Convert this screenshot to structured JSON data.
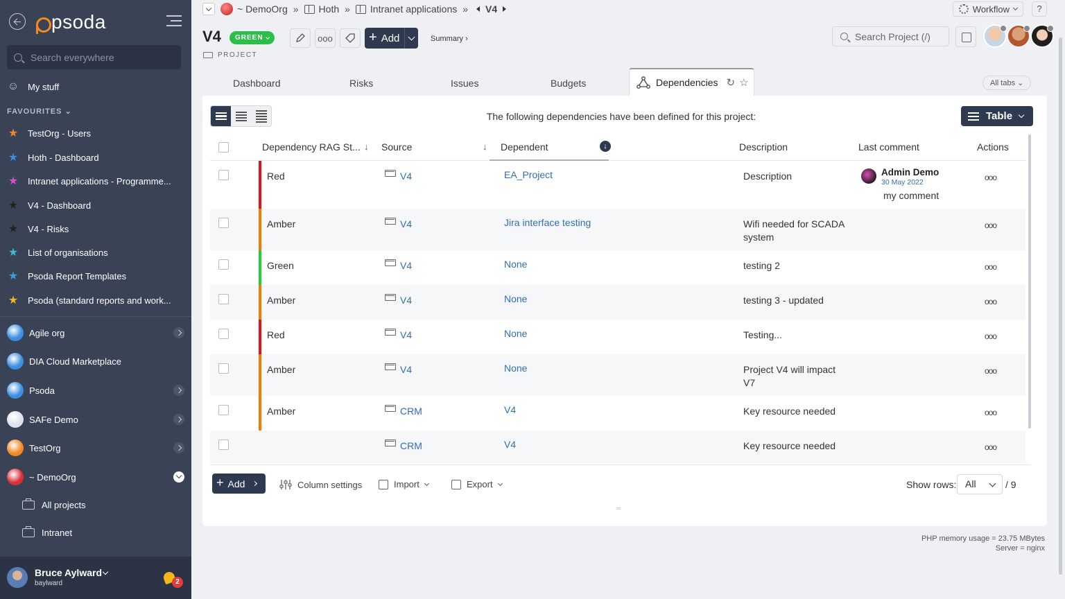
{
  "sidebar": {
    "logo_text": "psoda",
    "search_placeholder": "Search everywhere",
    "my_stuff": "My stuff",
    "favourites_title": "FAVOURITES",
    "favourites": [
      {
        "label": "TestOrg - Users",
        "color": "#f28a24"
      },
      {
        "label": "Hoth - Dashboard",
        "color": "#3c8fe0"
      },
      {
        "label": "Intranet applications - Programme...",
        "color": "#d44fd0"
      },
      {
        "label": "V4 - Dashboard",
        "color": "#222222"
      },
      {
        "label": "V4 - Risks",
        "color": "#222222"
      },
      {
        "label": "List of organisations",
        "color": "#3cb9d4"
      },
      {
        "label": "Psoda Report Templates",
        "color": "#3c9fe0"
      },
      {
        "label": "Psoda (standard reports and work...",
        "color": "#f5b81c"
      }
    ],
    "orgs": [
      {
        "label": "Agile org",
        "color": "#3c8fe0",
        "has_chevron": true
      },
      {
        "label": "DIA Cloud Marketplace",
        "color": "#3c8fe0",
        "has_chevron": false
      },
      {
        "label": "Psoda",
        "color": "#3c8fe0",
        "has_chevron": true
      },
      {
        "label": "SAFe Demo",
        "color": "#dde3ea",
        "has_chevron": true
      },
      {
        "label": "TestOrg",
        "color": "#f28a24",
        "has_chevron": true
      },
      {
        "label": "~ DemoOrg",
        "color": "#d9303c",
        "has_chevron": true,
        "open": true
      }
    ],
    "sub_items": [
      "All projects",
      "Intranet"
    ],
    "user": {
      "name": "Bruce Aylward",
      "username": "baylward",
      "notifications": "2"
    }
  },
  "breadcrumbs": {
    "org": "~ DemoOrg",
    "sep": "»",
    "items": [
      "Hoth",
      "Intranet applications"
    ],
    "current": "V4"
  },
  "topright": {
    "workflow": "Workflow",
    "help": "?"
  },
  "project": {
    "title": "V4",
    "status": "GREEN",
    "status_color": "#2bbf4a",
    "type": "PROJECT",
    "add_label": "Add",
    "summary_label": "Summary ›",
    "search_placeholder": "Search Project (/)"
  },
  "tabs": {
    "items": [
      "Dashboard",
      "Risks",
      "Issues",
      "Budgets"
    ],
    "active": "Dependencies",
    "all_tabs": "All tabs"
  },
  "table": {
    "intro": "The following dependencies have been defined for this project:",
    "view_button": "Table",
    "headers": {
      "rag": "Dependency RAG St...",
      "source": "Source",
      "dependent": "Dependent",
      "description": "Description",
      "last_comment": "Last comment",
      "actions": "Actions"
    },
    "actions_glyph": "ooo",
    "rows": [
      {
        "rag": "Red",
        "rag_color": "#e0131f",
        "source": "V4",
        "dependent": "EA_Project",
        "description": [
          "Description"
        ],
        "comment": {
          "author": "Admin Demo",
          "date": "30 May 2022",
          "text": "my comment"
        }
      },
      {
        "rag": "Amber",
        "rag_color": "#f57c00",
        "source": "V4",
        "dependent": "Jira interface testing",
        "description": [
          "Wifi needed for SCADA",
          "system"
        ]
      },
      {
        "rag": "Green",
        "rag_color": "#22d22e",
        "source": "V4",
        "dependent": "None",
        "description": [
          "testing 2"
        ]
      },
      {
        "rag": "Amber",
        "rag_color": "#f57c00",
        "source": "V4",
        "dependent": "None",
        "description": [
          "testing 3 - updated"
        ]
      },
      {
        "rag": "Red",
        "rag_color": "#e0131f",
        "source": "V4",
        "dependent": "None",
        "description": [
          "Testing..."
        ]
      },
      {
        "rag": "Amber",
        "rag_color": "#f57c00",
        "source": "V4",
        "dependent": "None",
        "description": [
          "Project V4 will impact",
          "V7"
        ]
      },
      {
        "rag": "Amber",
        "rag_color": "#f57c00",
        "source": "CRM",
        "dependent": "V4",
        "description": [
          "Key resource needed"
        ]
      },
      {
        "rag": "",
        "rag_color": "",
        "source": "CRM",
        "dependent": "V4",
        "description": [
          "Key resource needed"
        ]
      }
    ],
    "footer": {
      "add": "Add",
      "column_settings": "Column settings",
      "import": "Import",
      "export": "Export",
      "show_rows_label": "Show rows:",
      "show_rows_value": "All",
      "total": "/ 9"
    }
  },
  "memory": {
    "usage": "PHP memory usage = 23.75 MBytes",
    "server": "Server = nginx"
  }
}
